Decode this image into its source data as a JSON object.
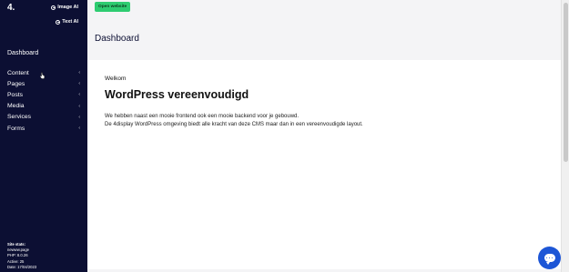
{
  "sidebar": {
    "logo": "4.",
    "image_ai": "Image AI",
    "text_ai": "Text AI",
    "dashboard": "Dashboard",
    "items": [
      {
        "label": "Content"
      },
      {
        "label": "Pages"
      },
      {
        "label": "Posts"
      },
      {
        "label": "Media"
      },
      {
        "label": "Services"
      },
      {
        "label": "Forms"
      }
    ],
    "chevron": "‹",
    "stats": {
      "title": "Site stats:",
      "page": "newww.page",
      "php": "PHP: 8.0.26",
      "active": "Active: 25",
      "date": "Date: 17/04/2023"
    }
  },
  "topbar": {
    "open_website": "Open website"
  },
  "main": {
    "page_title": "Dashboard",
    "welcome": "Welkom",
    "headline": "WordPress vereenvoudigd",
    "paragraph_1": "We hebben naast een mooie frontend ook een mooie backend voor je gebouwd.",
    "paragraph_2": "De 4display WordPress omgeving biedt alle kracht van deze CMS maar dan in een vereenvoudigde layout."
  },
  "colors": {
    "sidebar_bg": "#0c0f33",
    "accent_green": "#2ecc71",
    "chat_blue": "#1d56d6"
  }
}
